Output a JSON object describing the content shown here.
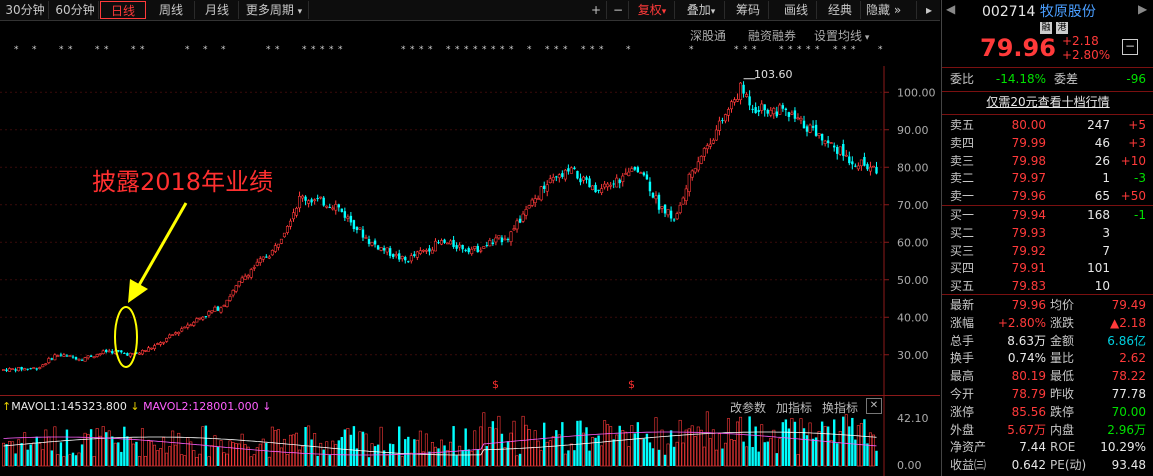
{
  "toolbar": {
    "period_tabs": [
      {
        "label": "30分钟",
        "active": false
      },
      {
        "label": "60分钟",
        "active": false
      },
      {
        "label": "日线",
        "active": true
      },
      {
        "label": "周线",
        "active": false
      },
      {
        "label": "月线",
        "active": false
      },
      {
        "label": "更多周期",
        "active": false,
        "dropdown": true
      }
    ],
    "plus": "+",
    "minus": "−",
    "fq_label": "复权",
    "overlay_label": "叠加",
    "chips_label": "筹码",
    "draw_label": "画线",
    "classic_label": "经典",
    "hide_label": "隐藏"
  },
  "subbar": {
    "links": [
      "深股通",
      "融资融券",
      "设置均线"
    ]
  },
  "annotation": {
    "text": "披露2018年业绩",
    "color": "#ff3030",
    "arrow_color": "#ffff00"
  },
  "chart_data": {
    "type": "candlestick",
    "price_axis": {
      "ticks": [
        100.0,
        90.0,
        80.0,
        70.0,
        60.0,
        50.0,
        40.0,
        30.0
      ],
      "labels": [
        "100.00",
        "90.00",
        "80.00",
        "70.00",
        "60.00",
        "50.00",
        "40.00",
        "30.00"
      ],
      "range": [
        23,
        107
      ]
    },
    "max_label": "103.60",
    "max_value": 103.6,
    "dividend_marks": [
      "$",
      "$"
    ],
    "volume_axis": {
      "labels": [
        "42.10",
        "0.00"
      ],
      "range": [
        0,
        42.1
      ]
    },
    "volume_legend": {
      "mavol1": "MAVOL1:145323.800",
      "mavol2": "MAVOL2:128001.000"
    },
    "trend_points": [
      [
        0,
        26
      ],
      [
        0.04,
        26.5
      ],
      [
        0.06,
        30
      ],
      [
        0.09,
        29
      ],
      [
        0.12,
        31
      ],
      [
        0.15,
        30
      ],
      [
        0.18,
        33
      ],
      [
        0.21,
        38
      ],
      [
        0.25,
        43
      ],
      [
        0.28,
        52
      ],
      [
        0.31,
        58
      ],
      [
        0.34,
        72
      ],
      [
        0.38,
        70
      ],
      [
        0.42,
        60
      ],
      [
        0.46,
        55
      ],
      [
        0.5,
        60
      ],
      [
        0.54,
        58
      ],
      [
        0.58,
        62
      ],
      [
        0.62,
        75
      ],
      [
        0.65,
        79
      ],
      [
        0.68,
        73
      ],
      [
        0.7,
        76
      ],
      [
        0.73,
        80
      ],
      [
        0.75,
        70
      ],
      [
        0.77,
        66
      ],
      [
        0.79,
        80
      ],
      [
        0.82,
        91
      ],
      [
        0.845,
        101
      ],
      [
        0.86,
        96
      ],
      [
        0.89,
        95
      ],
      [
        0.92,
        91
      ],
      [
        0.95,
        86
      ],
      [
        0.97,
        82
      ],
      [
        1.0,
        79
      ]
    ]
  },
  "volume_tools": {
    "params": "改参数",
    "add": "加指标",
    "switch": "换指标",
    "close": "✕"
  },
  "quote": {
    "code": "002714",
    "name": "牧原股份",
    "tag1": "融",
    "tag2": "港",
    "price": "79.96",
    "change": "+2.18",
    "change_pct": "+2.80%",
    "weibi_label": "委比",
    "weibi": "-14.18%",
    "weicha_label": "委差",
    "weicha": "-96",
    "level10_text": "仅需20元查看十档行情",
    "asks": [
      {
        "label": "卖五",
        "price": "80.00",
        "vol": "247",
        "chg": "+5"
      },
      {
        "label": "卖四",
        "price": "79.99",
        "vol": "46",
        "chg": "+3"
      },
      {
        "label": "卖三",
        "price": "79.98",
        "vol": "26",
        "chg": "+10"
      },
      {
        "label": "卖二",
        "price": "79.97",
        "vol": "1",
        "chg": "-3"
      },
      {
        "label": "卖一",
        "price": "79.96",
        "vol": "65",
        "chg": "+50"
      }
    ],
    "bids": [
      {
        "label": "买一",
        "price": "79.94",
        "vol": "168",
        "chg": "-1"
      },
      {
        "label": "买二",
        "price": "79.93",
        "vol": "3",
        "chg": ""
      },
      {
        "label": "买三",
        "price": "79.92",
        "vol": "7",
        "chg": ""
      },
      {
        "label": "买四",
        "price": "79.91",
        "vol": "101",
        "chg": ""
      },
      {
        "label": "买五",
        "price": "79.83",
        "vol": "10",
        "chg": ""
      }
    ],
    "stats": [
      {
        "l1": "最新",
        "v1": "79.96",
        "c1": "red",
        "l2": "均价",
        "v2": "79.49",
        "c2": "red"
      },
      {
        "l1": "涨幅",
        "v1": "+2.80%",
        "c1": "red",
        "l2": "涨跌",
        "v2": "▲2.18",
        "c2": "red"
      },
      {
        "l1": "总手",
        "v1": "8.63万",
        "c1": "wht",
        "l2": "金额",
        "v2": "6.86亿",
        "c2": "cyan"
      },
      {
        "l1": "换手",
        "v1": "0.74%",
        "c1": "wht",
        "l2": "量比",
        "v2": "2.62",
        "c2": "red"
      },
      {
        "l1": "最高",
        "v1": "80.19",
        "c1": "red",
        "l2": "最低",
        "v2": "78.22",
        "c2": "red"
      },
      {
        "l1": "今开",
        "v1": "78.79",
        "c1": "red",
        "l2": "昨收",
        "v2": "77.78",
        "c2": "wht"
      },
      {
        "l1": "涨停",
        "v1": "85.56",
        "c1": "red",
        "l2": "跌停",
        "v2": "70.00",
        "c2": "grn"
      },
      {
        "l1": "外盘",
        "v1": "5.67万",
        "c1": "red",
        "l2": "内盘",
        "v2": "2.96万",
        "c2": "grn"
      },
      {
        "l1": "净资产",
        "v1": "7.44",
        "c1": "wht",
        "l2": "ROE",
        "v2": "10.29%",
        "c2": "wht"
      },
      {
        "l1": "收益㈢",
        "v1": "0.642",
        "c1": "wht",
        "l2": "PE(动)",
        "v2": "93.48",
        "c2": "wht"
      }
    ]
  }
}
